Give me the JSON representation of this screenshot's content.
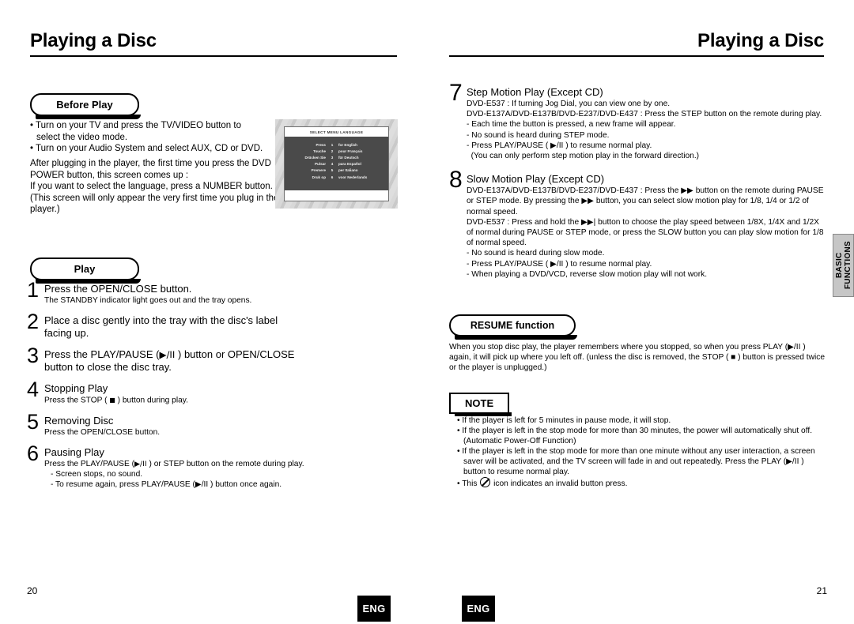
{
  "left_page": {
    "header_title": "Playing a Disc",
    "page_number": "20",
    "lang_badge": "ENG",
    "before_play": {
      "heading": "Before Play",
      "bullets": [
        "• Turn on your TV and press the TV/VIDEO button to select the video mode.",
        "• Turn on your Audio System and select AUX, CD or DVD."
      ],
      "paragraph_lines": [
        "After plugging in the player, the first time you press the DVD",
        "POWER button, this screen comes up :",
        "If you want to select the language, press a NUMBER button.",
        "(This screen will only appear the very first time you plug in the player.)"
      ]
    },
    "tv_screen": {
      "title": "SELECT MENU LANGUAGE",
      "rows": [
        {
          "verb": "Press",
          "num": "1",
          "lang": "for English"
        },
        {
          "verb": "Touche",
          "num": "2",
          "lang": "pour Français"
        },
        {
          "verb": "Drücken Sie",
          "num": "3",
          "lang": "für Deutsch"
        },
        {
          "verb": "Pulsar",
          "num": "4",
          "lang": "para Español"
        },
        {
          "verb": "Premere",
          "num": "5",
          "lang": "per Italiano"
        },
        {
          "verb": "Druk op",
          "num": "6",
          "lang": "voor Nederlands"
        }
      ]
    },
    "play": {
      "heading": "Play",
      "steps": [
        {
          "num": "1",
          "title": "Press the OPEN/CLOSE button.",
          "sub": [
            "The STANDBY indicator light goes out and the tray opens."
          ]
        },
        {
          "num": "2",
          "title": "Place a disc gently into the tray with the disc's label facing up.",
          "sub": []
        },
        {
          "num": "3",
          "title_pre": "Press the PLAY/PAUSE (",
          "title_post": ") button or OPEN/CLOSE button to close the disc tray.",
          "glyph": "play-pause",
          "sub": []
        },
        {
          "num": "4",
          "title": "Stopping Play",
          "sub_pre": "Press the STOP ( ",
          "sub_post": " ) button during play.",
          "glyph": "stop",
          "sub": []
        },
        {
          "num": "5",
          "title": "Removing Disc",
          "sub": [
            "Press the OPEN/CLOSE button."
          ]
        },
        {
          "num": "6",
          "title": "Pausing Play",
          "sub_main_pre": "Press the PLAY/PAUSE (",
          "sub_main_post": ") or STEP button on the remote during play.",
          "dashes": [
            "- Screen stops, no sound.",
            "- To resume again, press PLAY/PAUSE (▶/II ) button once again."
          ]
        }
      ]
    }
  },
  "right_page": {
    "header_title": "Playing a Disc",
    "page_number": "21",
    "lang_badge": "ENG",
    "side_tab": "BASIC\nFUNCTIONS",
    "steps": [
      {
        "num": "7",
        "title": "Step Motion Play (Except CD)",
        "lines": [
          "DVD-E537 : If turning Jog Dial, you can view one by one.",
          "DVD-E137A/DVD-E137B/DVD-E237/DVD-E437 : Press the STEP button on the remote during play.",
          "- Each time the button is pressed, a new frame will appear.",
          "- No sound is heard during STEP mode.",
          "- Press PLAY/PAUSE ( ▶/II ) to resume normal play.",
          "  (You can only perform step motion play in the forward direction.)"
        ]
      },
      {
        "num": "8",
        "title": "Slow Motion Play (Except CD)",
        "lines": [
          "DVD-E137A/DVD-E137B/DVD-E237/DVD-E437 : Press the ▶▶ button on the remote during PAUSE or STEP mode. By pressing the ▶▶ button, you can select slow motion play for 1/8, 1/4 or 1/2 of normal speed.",
          "DVD-E537 : Press and hold the ▶▶| button to choose the play speed between 1/8X, 1/4X and 1/2X of normal during PAUSE or STEP mode, or press the SLOW button you can play slow motion for 1/8 of normal speed.",
          "- No sound is heard during slow mode.",
          "- Press PLAY/PAUSE ( ▶/II ) to resume normal play.",
          "- When playing a DVD/VCD, reverse slow motion play will not work."
        ]
      }
    ],
    "resume": {
      "heading": "RESUME function",
      "text": "When you stop disc play, the player remembers where you stopped, so when you press PLAY (▶/II ) again, it will pick up where you left off. (unless the disc is removed, the STOP ( ■ ) button is pressed twice or the player is unplugged.)"
    },
    "note": {
      "heading": "NOTE",
      "bullets": [
        "• If the player is left for 5 minutes in pause mode, it will stop.",
        "• If the player is left in the stop mode for more than 30 minutes, the power will automatically shut off. (Automatic Power-Off Function)",
        "• If the player is left in the stop mode for more than one minute without any user interaction, a screen saver will be activated, and the TV screen will fade in and out repeatedly. Press the PLAY (▶/II ) button to resume normal play.",
        "• This   icon indicates an invalid button press."
      ],
      "last_bullet_pre": "• This ",
      "last_bullet_post": " icon indicates an invalid button press."
    }
  }
}
